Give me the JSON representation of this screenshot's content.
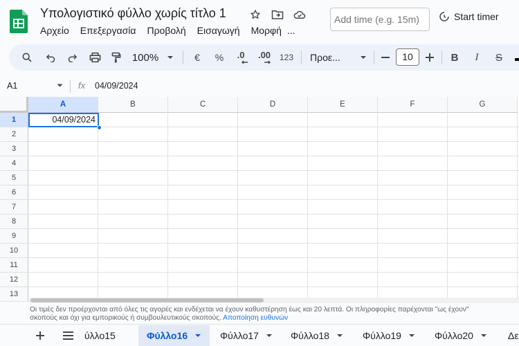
{
  "header": {
    "title": "Υπολογιστικό φύλλο χωρίς τίτλο 1",
    "menu": [
      "Αρχείο",
      "Επεξεργασία",
      "Προβολή",
      "Εισαγωγή",
      "Μορφή",
      "..."
    ],
    "time_placeholder": "Add time (e.g. 15m)",
    "start_timer": "Start timer"
  },
  "toolbar": {
    "zoom": "100%",
    "currency": "€",
    "percent": "%",
    "dec_decrease": ".0",
    "dec_increase": ".00",
    "number_format": "123",
    "font": "Προε...",
    "font_size": "10",
    "bold": "B",
    "italic": "I",
    "strike": "S"
  },
  "formula_bar": {
    "cell_ref": "A1",
    "fx": "fx",
    "value": "04/09/2024"
  },
  "grid": {
    "columns": [
      "A",
      "B",
      "C",
      "D",
      "E",
      "F",
      "G"
    ],
    "rows": [
      "1",
      "2",
      "3",
      "4",
      "5",
      "6",
      "7",
      "8",
      "9",
      "10",
      "11",
      "12",
      "13"
    ],
    "selected_cell_value": "04/09/2024"
  },
  "footer": {
    "disclaimer_line1": "Οι τιμές δεν προέρχονται από όλες τις αγορές και ενδέχεται να έχουν καθυστέρηση έως και 20 λεπτά. Οι πληροφορίες παρέχονται \"ως έχουν\"",
    "disclaimer_line2": "σκοπούς και όχι για εμπορικούς ή συμβουλευτικούς σκοπούς.",
    "disclaimer_link": "Αποποίηση ευθυνών"
  },
  "tabs": {
    "items": [
      "ύλλο15",
      "Φύλλο16",
      "Φύλλο17",
      "Φύλλο18",
      "Φύλλο19",
      "Φύλλο20",
      "Δε"
    ],
    "active_index": 1
  }
}
